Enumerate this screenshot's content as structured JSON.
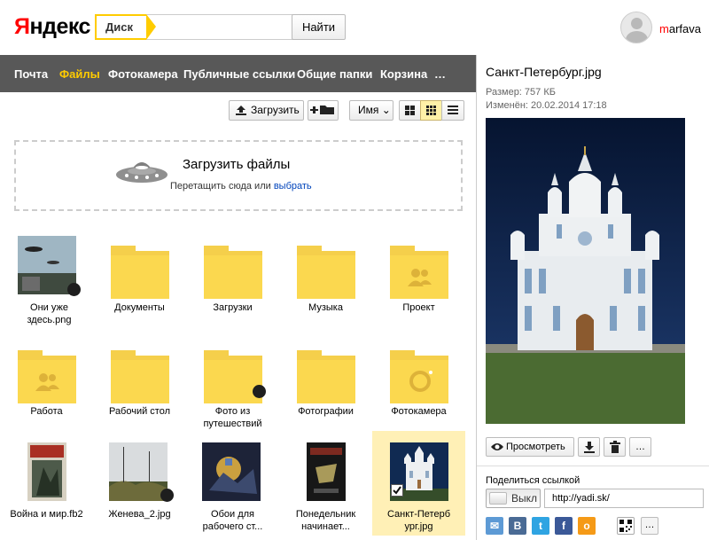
{
  "header": {
    "logo_prefix": "Я",
    "logo_rest": "ндекс",
    "search_tag": "Диск",
    "search_value": "",
    "search_button": "Найти",
    "user_first": "m",
    "user_rest": "arfava"
  },
  "nav": {
    "items": [
      "Почта",
      "Файлы",
      "Фотокамера",
      "Публичные ссылки",
      "Общие папки",
      "Корзина",
      "…"
    ],
    "active": "Файлы"
  },
  "toolbar": {
    "upload_label": "Загрузить",
    "sort_label": "Имя ⌄"
  },
  "dropzone": {
    "title": "Загрузить файлы",
    "hint": "Перетащить сюда или ",
    "link": "выбрать"
  },
  "files": [
    {
      "label_1": "Они уже",
      "label_2": "здесь.png",
      "kind": "image"
    },
    {
      "label_1": "Документы",
      "label_2": "",
      "kind": "folder"
    },
    {
      "label_1": "Загрузки",
      "label_2": "",
      "kind": "folder"
    },
    {
      "label_1": "Музыка",
      "label_2": "",
      "kind": "folder"
    },
    {
      "label_1": "Проект",
      "label_2": "",
      "kind": "folder-shared"
    },
    {
      "label_1": "Работа",
      "label_2": "",
      "kind": "folder-shared"
    },
    {
      "label_1": "Рабочий стол",
      "label_2": "",
      "kind": "folder"
    },
    {
      "label_1": "Фото из",
      "label_2": "путешествий",
      "kind": "folder-public"
    },
    {
      "label_1": "Фотографии",
      "label_2": "",
      "kind": "folder"
    },
    {
      "label_1": "Фотокамера",
      "label_2": "",
      "kind": "folder-camera"
    },
    {
      "label_1": "Война и мир.fb2",
      "label_2": "",
      "kind": "book"
    },
    {
      "label_1": "Женева_2.jpg",
      "label_2": "",
      "kind": "image"
    },
    {
      "label_1": "Обои для",
      "label_2": "рабочего ст...",
      "kind": "image"
    },
    {
      "label_1": "Понедельник",
      "label_2": "начинает...",
      "kind": "book"
    },
    {
      "label_1": "Санкт-Петерб",
      "label_2": "ург.jpg",
      "kind": "image",
      "selected": true
    }
  ],
  "details": {
    "title": "Санкт-Петербург.jpg",
    "size": "Размер: 757 КБ",
    "modified": "Изменён: 20.02.2014 17:18",
    "view_button": "Просмотреть",
    "more_button": "…",
    "share_label": "Поделиться ссылкой",
    "share_toggle": "Выкл",
    "share_url": "http://yadi.sk/",
    "social": [
      "✉",
      "В",
      "t",
      "f",
      "о"
    ],
    "social_more": "…"
  },
  "colors": {
    "accent": "#ffcc00",
    "nav_bg": "#585858",
    "folder": "#f5cf4b",
    "selection": "#fff0b6"
  }
}
